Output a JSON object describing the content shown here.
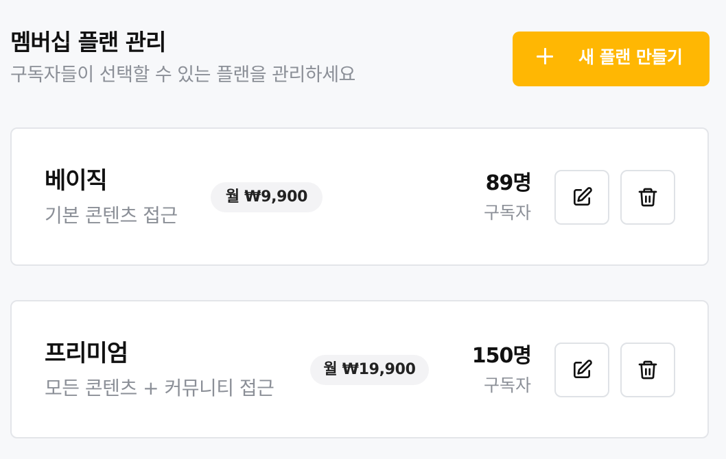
{
  "header": {
    "title": "멤버십 플랜 관리",
    "subtitle": "구독자들이 선택할 수 있는 플랜을 관리하세요"
  },
  "create_button": {
    "icon": "plus-icon",
    "label": "새 플랜 만들기"
  },
  "plans": [
    {
      "name": "베이직",
      "description": "기본 콘텐츠 접근",
      "price": "월 ₩9,900",
      "subscriber_count": "89명",
      "subscriber_label": "구독자",
      "edit_icon": "edit-icon",
      "delete_icon": "trash-icon"
    },
    {
      "name": "프리미엄",
      "description": "모든 콘텐츠 + 커뮤니티 접근",
      "price": "월 ₩19,900",
      "subscriber_count": "150명",
      "subscriber_label": "구독자",
      "edit_icon": "edit-icon",
      "delete_icon": "trash-icon"
    }
  ],
  "colors": {
    "accent": "#ffb703",
    "background": "#f7f8fa",
    "card": "#ffffff",
    "muted_text": "#8b8f97",
    "badge": "#f3f3f5"
  }
}
